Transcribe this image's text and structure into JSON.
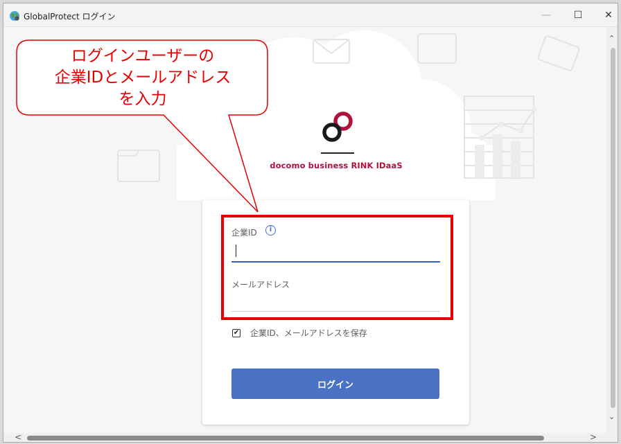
{
  "window": {
    "title": "GlobalProtect ログイン",
    "controls": {
      "minimize": "—",
      "maximize": "☐",
      "close": "✕"
    },
    "icons": [
      "globe-icon",
      "minimize-icon",
      "maximize-icon",
      "close-icon"
    ]
  },
  "brand": {
    "name": "docomo business RINK IDaaS",
    "color": "#b0123c"
  },
  "form": {
    "company_id_label": "企業ID",
    "info_icon_glyph": "i",
    "company_id_value": "",
    "email_label": "メールアドレス",
    "email_value": "",
    "save_label": "企業ID、メールアドレスを保存",
    "save_checked": true,
    "save_check_glyph": "✔",
    "login_button": "ログイン",
    "button_color": "#4a72c4"
  },
  "annotation": {
    "callout_lines": [
      "ログインユーザーの",
      "企業IDとメールアドレス",
      "を入力"
    ],
    "color": "#e60000"
  },
  "scrollbars": {
    "up_arrow": "⌃",
    "down_arrow": "⌄",
    "left_arrow": "<",
    "right_arrow": ">"
  }
}
